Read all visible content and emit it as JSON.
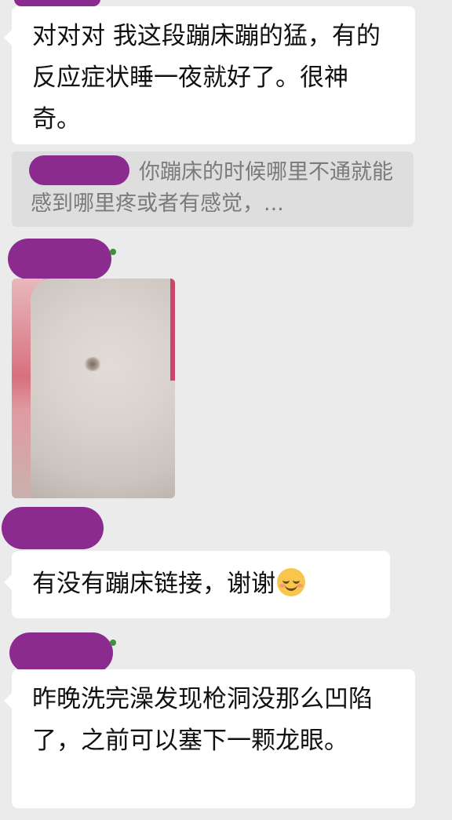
{
  "messages": {
    "m1": "对对对   我这段蹦床蹦的猛，有的反应症状睡一夜就好了。很神奇。",
    "quote": "你蹦床的时候哪里不通就能感到哪里疼或者有感觉，...",
    "m3": "有没有蹦床链接，谢谢",
    "m4": "昨晚洗完澡发现枪洞没那么凹陷了，之前可以塞下一颗龙眼。"
  },
  "colors": {
    "background": "#ebebeb",
    "bubble": "#ffffff",
    "redaction": "#8b2b8f"
  },
  "icons": {
    "emoji": "smiling-blushing-face"
  }
}
